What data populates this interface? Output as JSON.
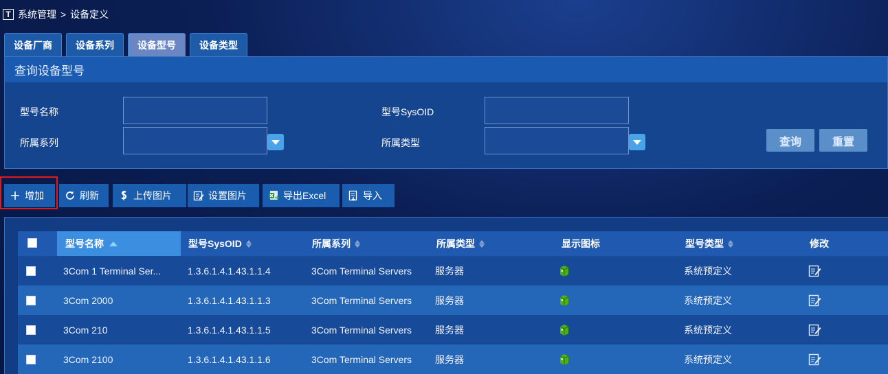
{
  "breadcrumb": {
    "logo": "T",
    "parent": "系统管理",
    "separator": ">",
    "current": "设备定义"
  },
  "tabs": [
    {
      "label": "设备厂商",
      "active": false
    },
    {
      "label": "设备系列",
      "active": false
    },
    {
      "label": "设备型号",
      "active": true
    },
    {
      "label": "设备类型",
      "active": false
    }
  ],
  "query": {
    "title": "查询设备型号",
    "model_name_label": "型号名称",
    "model_name_value": "",
    "sysoid_label": "型号SysOID",
    "sysoid_value": "",
    "series_label": "所属系列",
    "series_value": "",
    "type_label": "所属类型",
    "type_value": "",
    "search_button": "查询",
    "reset_button": "重置"
  },
  "toolbar": {
    "add": "增加",
    "refresh": "刷新",
    "upload_image": "上传图片",
    "set_image": "设置图片",
    "export_excel": "导出Excel",
    "import": "导入"
  },
  "table": {
    "columns": [
      "型号名称",
      "型号SysOID",
      "所属系列",
      "所属类型",
      "显示图标",
      "型号类型",
      "修改"
    ],
    "rows": [
      {
        "name": "3Com 1 Terminal Ser...",
        "sysoid": "1.3.6.1.4.1.43.1.1.4",
        "series": "3Com Terminal Servers",
        "type": "服务器",
        "model_type": "系统预定义"
      },
      {
        "name": "3Com 2000",
        "sysoid": "1.3.6.1.4.1.43.1.1.3",
        "series": "3Com Terminal Servers",
        "type": "服务器",
        "model_type": "系统预定义"
      },
      {
        "name": "3Com 210",
        "sysoid": "1.3.6.1.4.1.43.1.1.5",
        "series": "3Com Terminal Servers",
        "type": "服务器",
        "model_type": "系统预定义"
      },
      {
        "name": "3Com 2100",
        "sysoid": "1.3.6.1.4.1.43.1.1.6",
        "series": "3Com Terminal Servers",
        "type": "服务器",
        "model_type": "系统预定义"
      }
    ]
  },
  "colors": {
    "highlight": "#e01b1b",
    "accent": "#4aa3e8",
    "device_icon": "#4caf1a"
  }
}
